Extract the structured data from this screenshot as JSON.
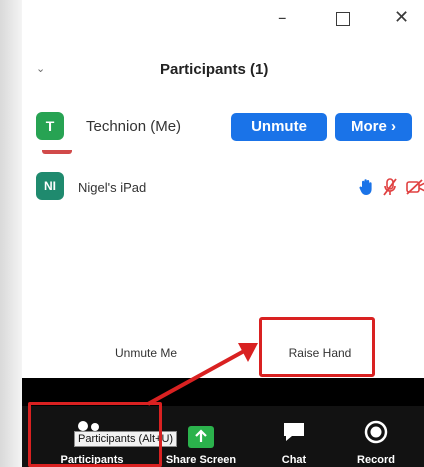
{
  "window": {
    "minimize": "–",
    "maximize": "",
    "close": "✕"
  },
  "header": {
    "title": "Participants (1)",
    "collapse_icon": "chevron-down-icon"
  },
  "participants": [
    {
      "initials": "T",
      "name": "Technion (Me)",
      "avatar_color": "#27a353",
      "actions": [
        "Unmute",
        "More ›"
      ]
    },
    {
      "initials": "NI",
      "name": "Nigel's iPad",
      "avatar_color": "#1f8a6e",
      "status_icons": [
        "raised-hand-icon",
        "muted-mic-icon",
        "camera-off-icon"
      ]
    }
  ],
  "panel_buttons": {
    "unmute_me": "Unmute Me",
    "raise_hand": "Raise Hand"
  },
  "toolbar": {
    "items": [
      {
        "label": "Participants",
        "icon": "participants-icon"
      },
      {
        "label": "Share Screen",
        "icon": "share-screen-icon"
      },
      {
        "label": "Chat",
        "icon": "chat-icon"
      },
      {
        "label": "Record",
        "icon": "record-icon"
      }
    ],
    "tooltip": "Participants (Alt+U)"
  },
  "colors": {
    "accent_blue": "#1a73e8",
    "annotation_red": "#d92121",
    "toolbar_bg": "#121212",
    "share_green": "#2bb24c"
  }
}
